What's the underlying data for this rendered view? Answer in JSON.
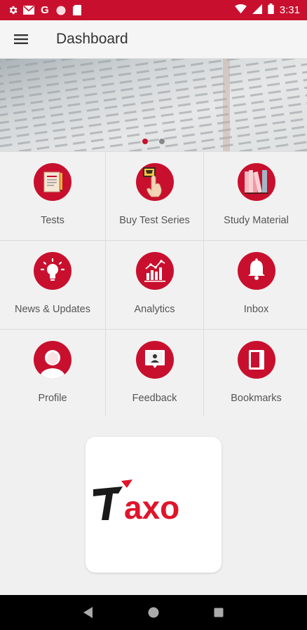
{
  "status_bar": {
    "time": "3:31",
    "left_icons": [
      "settings-icon",
      "mail-icon",
      "google-icon",
      "record-icon",
      "sd-card-icon"
    ],
    "right_icons": [
      "wifi-icon",
      "signal-icon",
      "battery-icon"
    ],
    "accent": "#c8102e"
  },
  "header": {
    "title": "Dashboard",
    "menu_icon": "hamburger-icon"
  },
  "banner": {
    "slides_total": 2,
    "active_slide": 1
  },
  "grid": {
    "items": [
      {
        "label": "Tests",
        "icon": "document-icon"
      },
      {
        "label": "Buy Test Series",
        "icon": "cart-tap-icon"
      },
      {
        "label": "Study Material",
        "icon": "books-icon"
      },
      {
        "label": "News & Updates",
        "icon": "lightbulb-icon"
      },
      {
        "label": "Analytics",
        "icon": "analytics-icon"
      },
      {
        "label": "Inbox",
        "icon": "bell-icon"
      },
      {
        "label": "Profile",
        "icon": "profile-icon"
      },
      {
        "label": "Feedback",
        "icon": "feedback-icon"
      },
      {
        "label": "Bookmarks",
        "icon": "bookmark-icon"
      }
    ]
  },
  "logo": {
    "text_first": "T",
    "text_rest": "axo",
    "colors": {
      "dark": "#1a1a1a",
      "brand": "#e0142a"
    }
  },
  "nav_bar": {
    "buttons": [
      "back-icon",
      "home-icon",
      "recents-icon"
    ]
  }
}
